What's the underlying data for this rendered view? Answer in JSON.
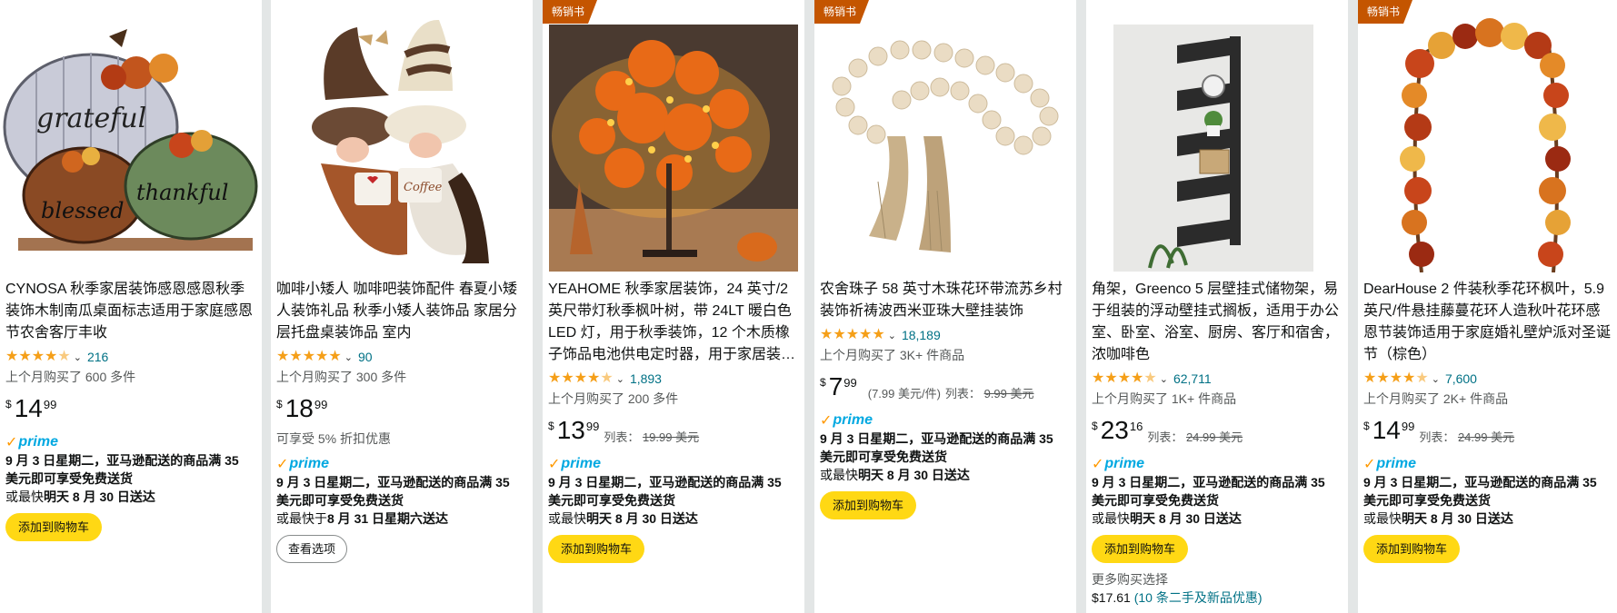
{
  "colors": {
    "badge": "#c45500",
    "cart_button": "#ffd814",
    "link": "#007185",
    "star": "#f59f18",
    "prime": "#00a8e1"
  },
  "products": [
    {
      "badge": "",
      "image_icon": "pumpkin-sign-icon",
      "title": "CYNOSA 秋季家居装饰感恩感恩秋季装饰木制南瓜桌面标志适用于家庭感恩节农舍客厅丰收",
      "rating_count": "216",
      "bought": "上个月购买了 600 多件",
      "price_whole": "14",
      "price_frac": "99",
      "currency": "$",
      "prime": "prime",
      "delivery_line1": "9 月 3 日星期二，亚马逊配送的商品满 35 美元即可享受免费送货",
      "delivery_prefix": "或最快",
      "delivery_bold": "明天 8 月 30 日送达",
      "button": "添加到购物车"
    },
    {
      "badge": "",
      "image_icon": "gnome-coffee-icon",
      "title": "咖啡小矮人 咖啡吧装饰配件 春夏小矮人装饰礼品 秋季小矮人装饰品 家居分层托盘桌装饰品 室内",
      "rating_count": "90",
      "bought": "上个月购买了 300 多件",
      "price_whole": "18",
      "price_frac": "99",
      "currency": "$",
      "discount": "可享受 5% 折扣优惠",
      "prime": "prime",
      "delivery_line1": "9 月 3 日星期二，亚马逊配送的商品满 35 美元即可享受免费送货",
      "delivery_prefix": "或最快于",
      "delivery_bold": "8 月 31 日星期六送达",
      "button": "查看选项"
    },
    {
      "badge": "畅销书",
      "image_icon": "maple-tree-lamp-icon",
      "title": "YEAHOME 秋季家居装饰，24 英寸/2 英尺带灯秋季枫叶树，带 24LT 暖白色 LED 灯，用于秋季装饰，12 个木质橡子饰品电池供电定时器，用于家居装…",
      "rating_count": "1,893",
      "bought": "上个月购买了 200 多件",
      "price_whole": "13",
      "price_frac": "99",
      "currency": "$",
      "list_label": "列表：",
      "list_price": "19.99 美元",
      "prime": "prime",
      "delivery_line1": "9 月 3 日星期二，亚马逊配送的商品满 35 美元即可享受免费送货",
      "delivery_prefix": "或最快",
      "delivery_bold": "明天 8 月 30 日送达",
      "button": "添加到购物车"
    },
    {
      "badge": "畅销书",
      "image_icon": "wood-bead-garland-icon",
      "title": "农舍珠子 58 英寸木珠花环带流苏乡村装饰祈祷波西米亚珠大壁挂装饰",
      "rating_count": "18,189",
      "bought": "上个月购买了 3K+ 件商品",
      "price_whole": "7",
      "price_frac": "99",
      "currency": "$",
      "unit_price": "(7.99 美元/件)",
      "list_label": "列表：",
      "list_price": "9.99 美元",
      "prime": "prime",
      "delivery_line1": "9 月 3 日星期二，亚马逊配送的商品满 35 美元即可享受免费送货",
      "delivery_prefix": "或最快",
      "delivery_bold": "明天 8 月 30 日送达",
      "button": "添加到购物车"
    },
    {
      "badge": "",
      "image_icon": "corner-shelf-icon",
      "title": "角架，Greenco 5 层壁挂式储物架，易于组装的浮动壁挂式搁板，适用于办公室、卧室、浴室、厨房、客厅和宿舍，浓咖啡色",
      "rating_count": "62,711",
      "bought": "上个月购买了 1K+ 件商品",
      "price_whole": "23",
      "price_frac": "16",
      "currency": "$",
      "list_label": "列表：",
      "list_price": "24.99 美元",
      "prime": "prime",
      "delivery_line1": "9 月 3 日星期二，亚马逊配送的商品满 35 美元即可享受免费送货",
      "delivery_prefix": "或最快",
      "delivery_bold": "明天 8 月 30 日送达",
      "button": "添加到购物车",
      "more_buying": "更多购买选择",
      "used_price": "$17.61",
      "used_offers": "(10 条二手及新品优惠)"
    },
    {
      "badge": "畅销书",
      "image_icon": "autumn-garland-icon",
      "title": "DearHouse 2 件装秋季花环枫叶，5.9 英尺/件悬挂藤蔓花环人造秋叶花环感恩节装饰适用于家庭婚礼壁炉派对圣诞节（棕色）",
      "rating_count": "7,600",
      "bought": "上个月购买了 2K+ 件商品",
      "price_whole": "14",
      "price_frac": "99",
      "currency": "$",
      "list_label": "列表：",
      "list_price": "24.99 美元",
      "prime": "prime",
      "delivery_line1": "9 月 3 日星期二，亚马逊配送的商品满 35 美元即可享受免费送货",
      "delivery_prefix": "或最快",
      "delivery_bold": "明天 8 月 30 日送达",
      "button": "添加到购物车"
    }
  ]
}
